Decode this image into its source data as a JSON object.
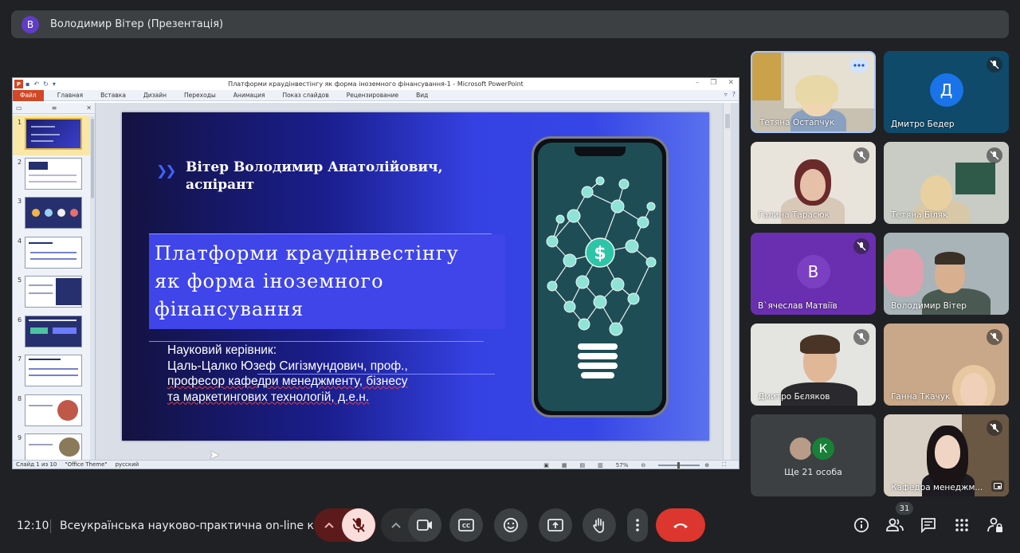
{
  "presenter": {
    "avatar_letter": "В",
    "label": "Володимир Вітер (Презентація)"
  },
  "powerpoint": {
    "logo": "P",
    "window_title": "Платформи краудінвестінгу як форма іноземного фінансування-1 - Microsoft PowerPoint",
    "file_tab": "Файл",
    "tabs": [
      "Главная",
      "Вставка",
      "Дизайн",
      "Переходы",
      "Анимация",
      "Показ слайдов",
      "Рецензирование",
      "Вид"
    ],
    "thumb_numbers": [
      "1",
      "2",
      "3",
      "4",
      "5",
      "6",
      "7",
      "8",
      "9"
    ],
    "status": {
      "slide": "Слайд 1 из 10",
      "theme": "\"Office Theme\"",
      "lang": "русский",
      "zoom": "57%"
    }
  },
  "slide": {
    "author_line1": "Вітер Володимир Анатолійович,",
    "author_line2": "аспірант",
    "title_line1": "Платформи краудінвестінгу",
    "title_line2": "як форма іноземного",
    "title_line3": "фінансування",
    "advisor_line1": "Науковий керівник:",
    "advisor_line2": "Цаль-Цалко Юзеф Сигізмундович, проф.,",
    "advisor_line3": "професор кафедри менеджменту, бізнесу",
    "advisor_line4": "та маркетингових технологій, д.е.н."
  },
  "participants": [
    {
      "name": "Тетяна Остапчук",
      "type": "video",
      "highlighted": true
    },
    {
      "name": "Дмитро Бедер",
      "type": "avatar",
      "letter": "Д",
      "avatar_color": "#1a73e8",
      "bg": "#0f4a6b"
    },
    {
      "name": "Галина Тарасюк",
      "type": "video"
    },
    {
      "name": "Тетяна Біляк",
      "type": "video"
    },
    {
      "name": "В`ячеслав Матвіїв",
      "type": "avatar",
      "letter": "В",
      "avatar_color": "#7b3fc2",
      "bg": "#6a2fb0"
    },
    {
      "name": "Володимир Вітер",
      "type": "video"
    },
    {
      "name": "Дмитро Бєляков",
      "type": "video"
    },
    {
      "name": "Ганна Ткачук",
      "type": "video"
    },
    {
      "name": "Кафедра менеджм...",
      "type": "video"
    }
  ],
  "more_tile": {
    "avatar_letter": "К",
    "label": "Ще 21 особа"
  },
  "bottom": {
    "time": "12:10",
    "meeting_title": "Всеукраїнська науково-практична on-line к...",
    "people_count": "31"
  }
}
